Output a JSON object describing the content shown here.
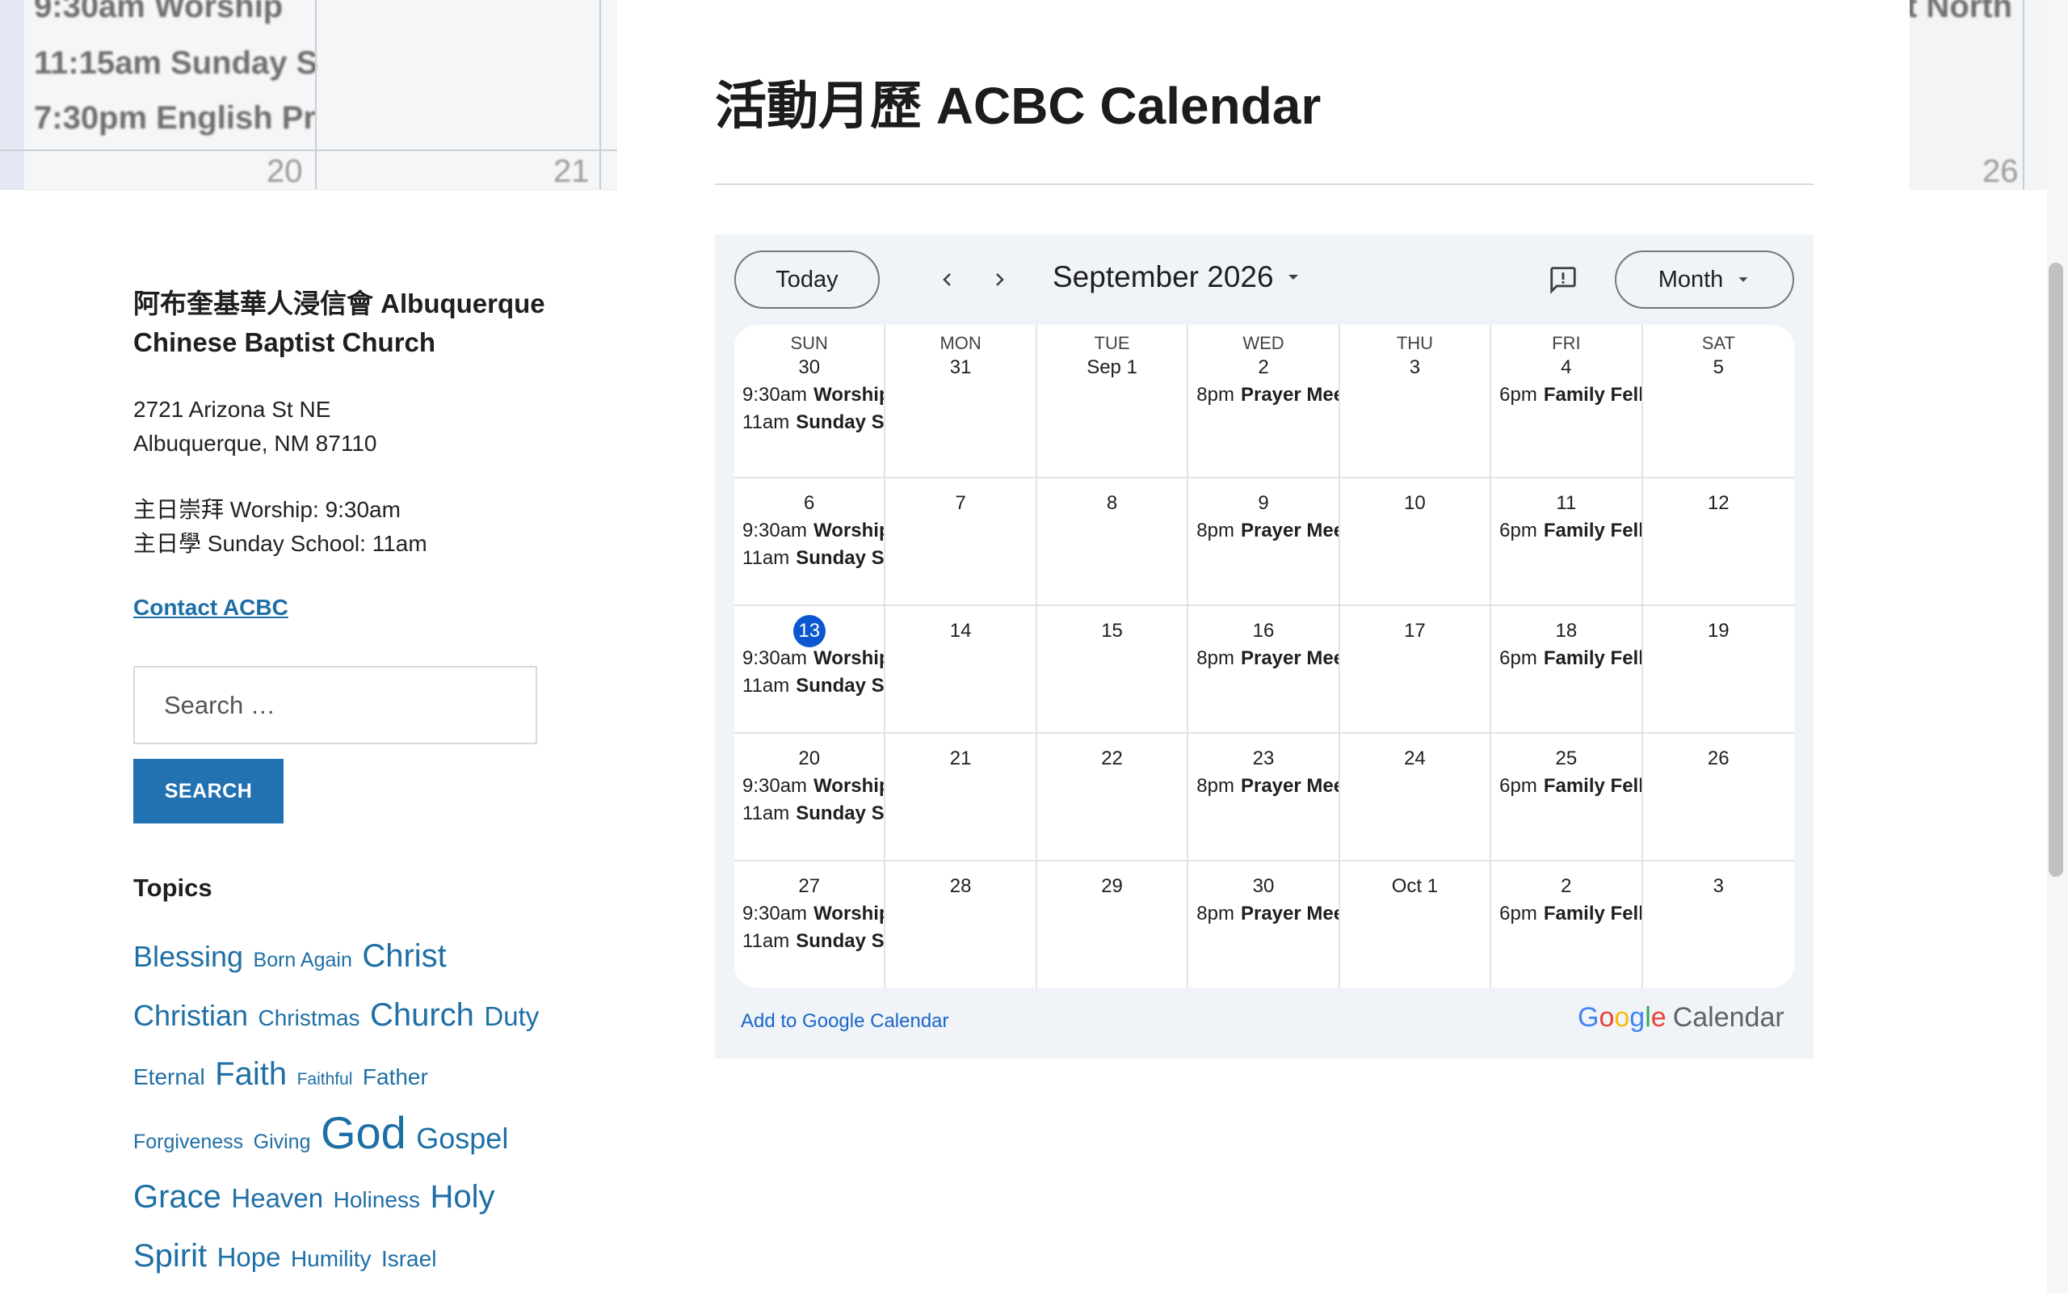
{
  "header_image": {
    "left_lines": [
      "9:30am Worship",
      "11:15am Sunday S",
      "7:30pm English Pr"
    ],
    "left_numbers": [
      "20",
      "21"
    ],
    "right_text": "t North",
    "right_number": "26"
  },
  "sidebar": {
    "church_name": "阿布奎基華人浸信會 Albuquerque Chinese Baptist Church",
    "address_line1": "2721 Arizona St NE",
    "address_line2": "Albuquerque, NM 87110",
    "worship": "主日崇拜 Worship: 9:30am",
    "sunday_school": "主日學 Sunday School: 11am",
    "contact_link": "Contact ACBC",
    "search_placeholder": "Search …",
    "search_button": "SEARCH",
    "topics_title": "Topics",
    "topics": [
      {
        "label": "Blessing",
        "size": "xl"
      },
      {
        "label": "Born Again",
        "size": "s"
      },
      {
        "label": "Christ",
        "size": "xxl"
      },
      {
        "label": "Christian",
        "size": "xl"
      },
      {
        "label": "Christmas",
        "size": "m"
      },
      {
        "label": "Church",
        "size": "xxl"
      },
      {
        "label": "Duty",
        "size": "l"
      },
      {
        "label": "Eternal",
        "size": "m"
      },
      {
        "label": "Faith",
        "size": "xxl"
      },
      {
        "label": "Faithful",
        "size": "xs"
      },
      {
        "label": "Father",
        "size": "m"
      },
      {
        "label": "Forgiveness",
        "size": "s"
      },
      {
        "label": "Giving",
        "size": "s"
      },
      {
        "label": "God",
        "size": "huge"
      },
      {
        "label": "Gospel",
        "size": "xl"
      },
      {
        "label": "Grace",
        "size": "xxl"
      },
      {
        "label": "Heaven",
        "size": "l"
      },
      {
        "label": "Holiness",
        "size": "m"
      },
      {
        "label": "Holy",
        "size": "xxl"
      },
      {
        "label": "Spirit",
        "size": "xxl"
      },
      {
        "label": "Hope",
        "size": "l"
      },
      {
        "label": "Humility",
        "size": "m"
      },
      {
        "label": "Israel",
        "size": "m"
      }
    ]
  },
  "main": {
    "title": "活動月歷 ACBC Calendar"
  },
  "calendar": {
    "today_button": "Today",
    "month_label": "September 2026",
    "view_button": "Month",
    "add_link": "Add to Google Calendar",
    "brand": "Calendar",
    "weekdays": [
      "SUN",
      "MON",
      "TUE",
      "WED",
      "THU",
      "FRI",
      "SAT"
    ],
    "weeks": [
      [
        {
          "day": "30",
          "events": [
            {
              "time": "9:30am",
              "name": "Worship"
            },
            {
              "time": "11am",
              "name": "Sunday School"
            }
          ]
        },
        {
          "day": "31",
          "events": []
        },
        {
          "day": "Sep 1",
          "events": []
        },
        {
          "day": "2",
          "events": [
            {
              "time": "8pm",
              "name": "Prayer Meeting"
            }
          ]
        },
        {
          "day": "3",
          "events": []
        },
        {
          "day": "4",
          "events": [
            {
              "time": "6pm",
              "name": "Family Fellowship"
            }
          ]
        },
        {
          "day": "5",
          "events": []
        }
      ],
      [
        {
          "day": "6",
          "events": [
            {
              "time": "9:30am",
              "name": "Worship"
            },
            {
              "time": "11am",
              "name": "Sunday School"
            }
          ]
        },
        {
          "day": "7",
          "events": []
        },
        {
          "day": "8",
          "events": []
        },
        {
          "day": "9",
          "events": [
            {
              "time": "8pm",
              "name": "Prayer Meeting"
            }
          ]
        },
        {
          "day": "10",
          "events": []
        },
        {
          "day": "11",
          "events": [
            {
              "time": "6pm",
              "name": "Family Fellowship"
            }
          ]
        },
        {
          "day": "12",
          "events": []
        }
      ],
      [
        {
          "day": "13",
          "today": true,
          "events": [
            {
              "time": "9:30am",
              "name": "Worship"
            },
            {
              "time": "11am",
              "name": "Sunday School"
            }
          ]
        },
        {
          "day": "14",
          "events": []
        },
        {
          "day": "15",
          "events": []
        },
        {
          "day": "16",
          "events": [
            {
              "time": "8pm",
              "name": "Prayer Meeting"
            }
          ]
        },
        {
          "day": "17",
          "events": []
        },
        {
          "day": "18",
          "events": [
            {
              "time": "6pm",
              "name": "Family Fellowship"
            }
          ]
        },
        {
          "day": "19",
          "events": []
        }
      ],
      [
        {
          "day": "20",
          "events": [
            {
              "time": "9:30am",
              "name": "Worship"
            },
            {
              "time": "11am",
              "name": "Sunday School"
            }
          ]
        },
        {
          "day": "21",
          "events": []
        },
        {
          "day": "22",
          "events": []
        },
        {
          "day": "23",
          "events": [
            {
              "time": "8pm",
              "name": "Prayer Meeting"
            }
          ]
        },
        {
          "day": "24",
          "events": []
        },
        {
          "day": "25",
          "events": [
            {
              "time": "6pm",
              "name": "Family Fellowship"
            }
          ]
        },
        {
          "day": "26",
          "events": []
        }
      ],
      [
        {
          "day": "27",
          "events": [
            {
              "time": "9:30am",
              "name": "Worship"
            },
            {
              "time": "11am",
              "name": "Sunday School"
            }
          ]
        },
        {
          "day": "28",
          "events": []
        },
        {
          "day": "29",
          "events": []
        },
        {
          "day": "30",
          "events": [
            {
              "time": "8pm",
              "name": "Prayer Meeting"
            }
          ]
        },
        {
          "day": "Oct 1",
          "events": []
        },
        {
          "day": "2",
          "events": [
            {
              "time": "6pm",
              "name": "Family Fellowship"
            }
          ]
        },
        {
          "day": "3",
          "events": []
        }
      ]
    ]
  },
  "colors": {
    "accent": "#2271b1",
    "link": "#1e6fa6",
    "today_marker": "#0b57d0",
    "calendar_bg": "#f0f4f9"
  }
}
